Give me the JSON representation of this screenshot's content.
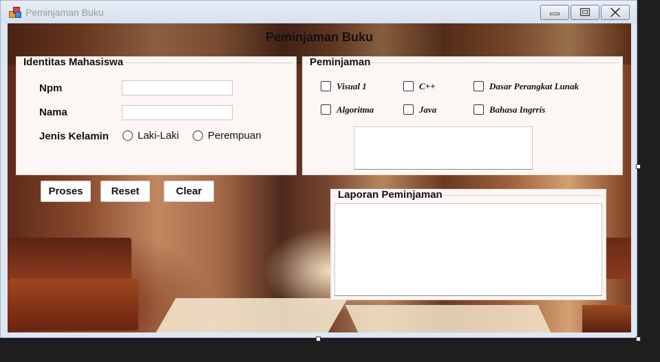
{
  "window": {
    "title": "Peminjaman Buku"
  },
  "form": {
    "heading": "Peminjaman Buku"
  },
  "identitas": {
    "legend": "Identitas Mahasiswa",
    "npm_label": "Npm",
    "npm_value": "",
    "nama_label": "Nama",
    "nama_value": "",
    "gender_label": "Jenis Kelamin",
    "gender_options": [
      "Laki-Laki",
      "Perempuan"
    ]
  },
  "peminjaman": {
    "legend": "Peminjaman",
    "books": [
      "Visual 1",
      "C++",
      "Dasar Perangkat Lunak",
      "Algoritma",
      "Java",
      "Bahasa Ingrris"
    ]
  },
  "buttons": {
    "proses": "Proses",
    "reset": "Reset",
    "clear": "Clear"
  },
  "laporan": {
    "legend": "Laporan Peminjaman"
  },
  "colors": {
    "group_bg": "#fcf6f4",
    "titlebar": "#dfe7f2"
  }
}
